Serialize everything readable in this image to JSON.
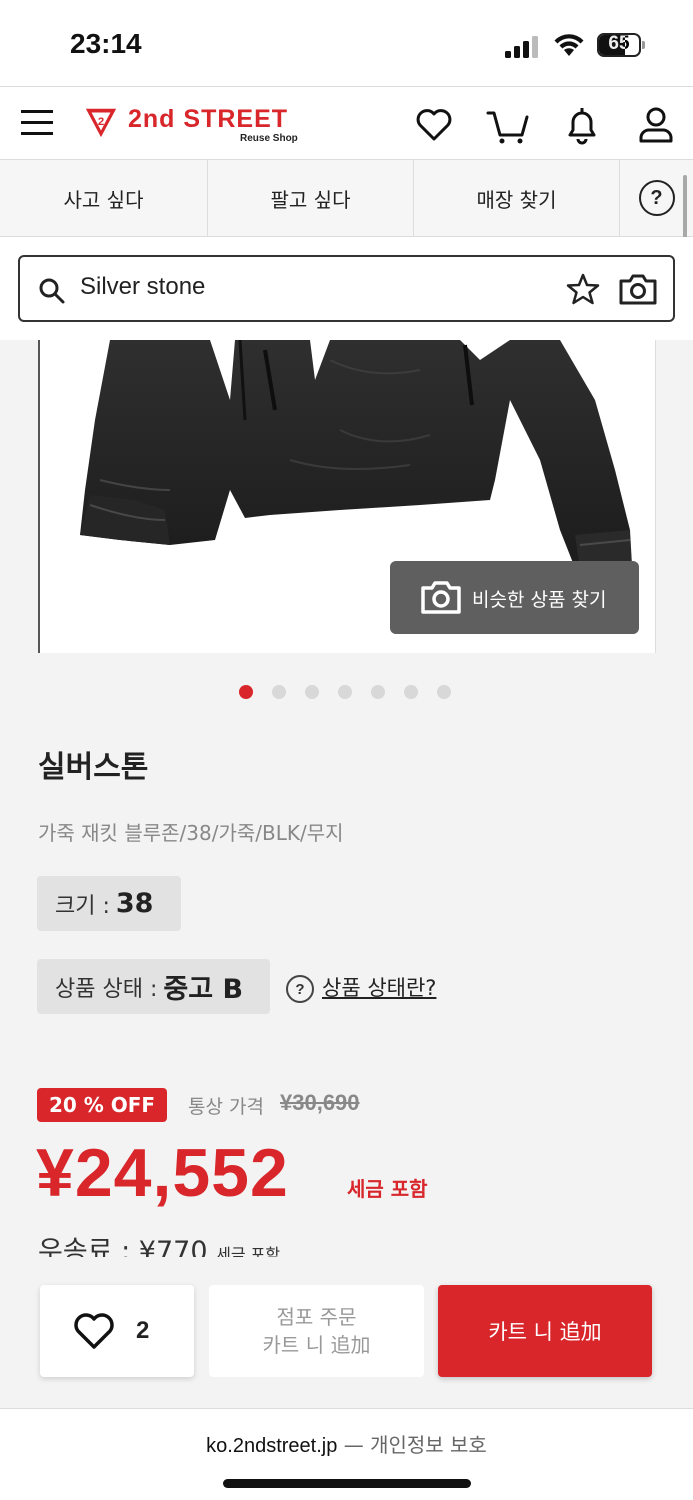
{
  "status_bar": {
    "time": "23:14",
    "battery_level": "65",
    "battery_fraction": 0.65
  },
  "header": {
    "logo_text": "2nd STREET",
    "logo_sub": "Reuse Shop",
    "logo_badge": "2",
    "icons": [
      "menu-icon",
      "heart-icon",
      "cart-icon",
      "bell-icon",
      "user-icon"
    ]
  },
  "tabs": [
    {
      "label": "사고 싶다"
    },
    {
      "label": "팔고 싶다"
    },
    {
      "label": "매장 찾기"
    }
  ],
  "help_symbol": "?",
  "search": {
    "value": "Silver stone"
  },
  "gallery": {
    "similar_button_label": "비슷한 상품 찾기",
    "total_images": 7,
    "active_index": 0
  },
  "product": {
    "brand": "실버스톤",
    "description": "가죽 재킷 블루존/38/가죽/BLK/무지",
    "size_label": "크기 :",
    "size_value": "38",
    "condition_label": "상품 상태 :",
    "condition_value": "중고 B",
    "condition_help_link": "상품 상태란?"
  },
  "pricing": {
    "discount_badge": "20 % OFF",
    "regular_label": "통상 가격",
    "regular_price": "¥30,690",
    "price": "¥24,552",
    "tax_note": "세금 포함",
    "shipping_label": "우송료 : ¥770",
    "shipping_tax": "세금 포함"
  },
  "actions": {
    "favorite_count": "2",
    "store_order_line1": "점포 주문",
    "store_order_line2": "카트 니 追加",
    "add_to_cart": "카트 니 追加"
  },
  "browser": {
    "domain": "ko.2ndstreet.jp",
    "privacy": "— 개인정보 보호"
  },
  "colors": {
    "brand_red": "#d8262a",
    "chip_bg": "#e2e2e2",
    "overlay_button": "#5f5f5f"
  }
}
